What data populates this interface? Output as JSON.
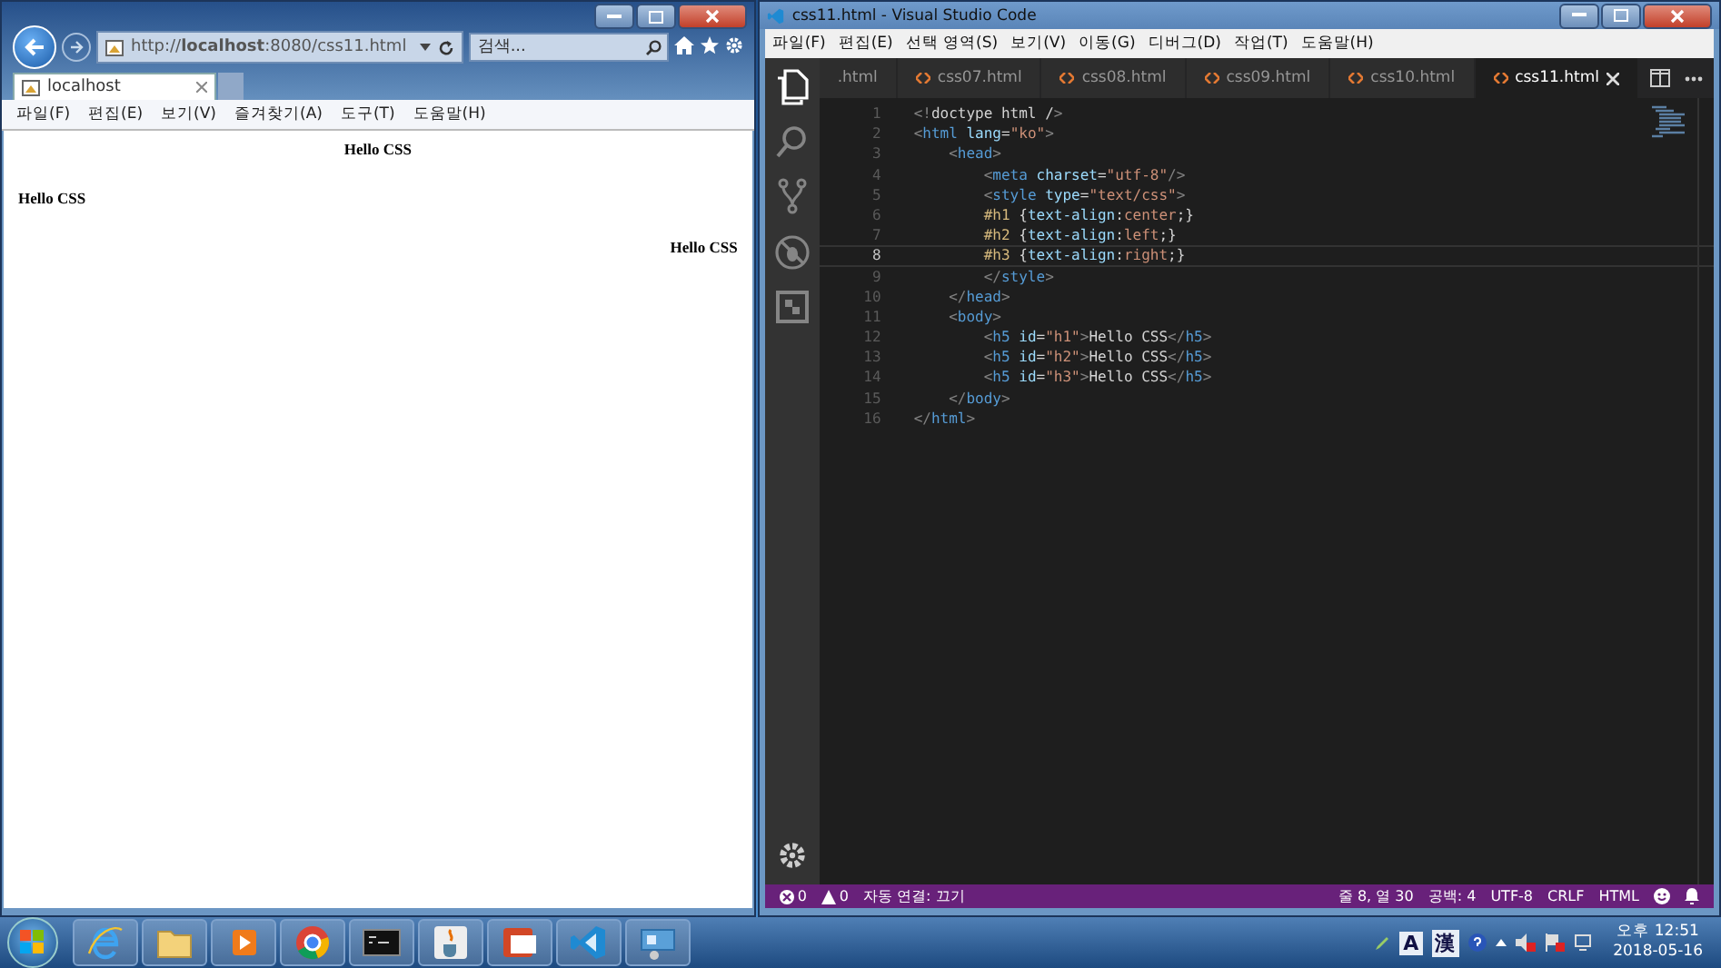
{
  "browser": {
    "address": "http://**localhost**:8080/css11.html",
    "search": {
      "placeholder": "검색..."
    },
    "tabs": [
      {
        "label": "localhost",
        "selected": true
      }
    ],
    "menu": [
      "파일(F)",
      "편집(E)",
      "보기(V)",
      "즐겨찾기(A)",
      "도구(T)",
      "도움말(H)"
    ],
    "page": {
      "headings": [
        {
          "text": "Hello CSS",
          "kind": "center"
        },
        {
          "text": "Hello CSS",
          "kind": "left"
        },
        {
          "text": "Hello CSS",
          "kind": "right"
        }
      ]
    }
  },
  "editor": {
    "window": {
      "title": "css11.html - Visual Studio Code"
    },
    "menu": [
      "파일(F)",
      "편집(E)",
      "선택 영역(S)",
      "보기(V)",
      "이동(G)",
      "디버그(D)",
      "작업(T)",
      "도움말(H)"
    ],
    "activity": [
      {
        "kind": "files",
        "selected": true
      },
      {
        "kind": "search",
        "selected": false
      },
      {
        "kind": "git",
        "selected": false
      },
      {
        "kind": "debug",
        "selected": false
      },
      {
        "kind": "extensions",
        "selected": false
      }
    ],
    "tabs": [
      {
        "label": ".html",
        "selected": false
      },
      {
        "label": "css07.html",
        "selected": false
      },
      {
        "label": "css08.html",
        "selected": false
      },
      {
        "label": "css09.html",
        "selected": false
      },
      {
        "label": "css10.html",
        "selected": false
      },
      {
        "label": "css11.html",
        "selected": true
      }
    ],
    "lines": [
      {
        "number": "1",
        "current": false,
        "tokens": [
          {
            "kind": "punct",
            "text": "<!"
          },
          {
            "kind": "text",
            "text": "doctype html /"
          },
          {
            "kind": "punct",
            "text": ">"
          }
        ]
      },
      {
        "number": "2",
        "current": false,
        "tokens": [
          {
            "kind": "punct",
            "text": "<"
          },
          {
            "kind": "tag",
            "text": "html"
          },
          {
            "kind": "attr",
            "text": " lang"
          },
          {
            "kind": "text",
            "text": "="
          },
          {
            "kind": "str",
            "text": "\"ko\""
          },
          {
            "kind": "punct",
            "text": ">"
          }
        ]
      },
      {
        "number": "3",
        "current": false,
        "tokens": [
          {
            "kind": "punct",
            "text": "    <"
          },
          {
            "kind": "tag",
            "text": "head"
          },
          {
            "kind": "punct",
            "text": ">"
          }
        ]
      },
      {
        "number": "4",
        "current": false,
        "tokens": [
          {
            "kind": "punct",
            "text": "        <"
          },
          {
            "kind": "tag",
            "text": "meta"
          },
          {
            "kind": "attr",
            "text": " charset"
          },
          {
            "kind": "text",
            "text": "="
          },
          {
            "kind": "str",
            "text": "\"utf-8\""
          },
          {
            "kind": "punct",
            "text": "/>"
          }
        ]
      },
      {
        "number": "5",
        "current": false,
        "tokens": [
          {
            "kind": "punct",
            "text": "        <"
          },
          {
            "kind": "tag",
            "text": "style"
          },
          {
            "kind": "attr",
            "text": " type"
          },
          {
            "kind": "text",
            "text": "="
          },
          {
            "kind": "str",
            "text": "\"text/css\""
          },
          {
            "kind": "punct",
            "text": ">"
          }
        ]
      },
      {
        "number": "6",
        "current": false,
        "tokens": [
          {
            "kind": "sel",
            "text": "        #h1"
          },
          {
            "kind": "text",
            "text": " {"
          },
          {
            "kind": "attr",
            "text": "text-align"
          },
          {
            "kind": "text",
            "text": ":"
          },
          {
            "kind": "str",
            "text": "center"
          },
          {
            "kind": "text",
            "text": ";}"
          }
        ]
      },
      {
        "number": "7",
        "current": false,
        "tokens": [
          {
            "kind": "sel",
            "text": "        #h2"
          },
          {
            "kind": "text",
            "text": " {"
          },
          {
            "kind": "attr",
            "text": "text-align"
          },
          {
            "kind": "text",
            "text": ":"
          },
          {
            "kind": "str",
            "text": "left"
          },
          {
            "kind": "text",
            "text": ";}"
          }
        ]
      },
      {
        "number": "8",
        "current": true,
        "tokens": [
          {
            "kind": "sel",
            "text": "        #h3"
          },
          {
            "kind": "text",
            "text": " {"
          },
          {
            "kind": "attr",
            "text": "text-align"
          },
          {
            "kind": "text",
            "text": ":"
          },
          {
            "kind": "str",
            "text": "right"
          },
          {
            "kind": "text",
            "text": ";}"
          }
        ]
      },
      {
        "number": "9",
        "current": false,
        "tokens": [
          {
            "kind": "punct",
            "text": "        </"
          },
          {
            "kind": "tag",
            "text": "style"
          },
          {
            "kind": "punct",
            "text": ">"
          }
        ]
      },
      {
        "number": "10",
        "current": false,
        "tokens": [
          {
            "kind": "punct",
            "text": "    </"
          },
          {
            "kind": "tag",
            "text": "head"
          },
          {
            "kind": "punct",
            "text": ">"
          }
        ]
      },
      {
        "number": "11",
        "current": false,
        "tokens": [
          {
            "kind": "punct",
            "text": "    <"
          },
          {
            "kind": "tag",
            "text": "body"
          },
          {
            "kind": "punct",
            "text": ">"
          }
        ]
      },
      {
        "number": "12",
        "current": false,
        "tokens": [
          {
            "kind": "punct",
            "text": "        <"
          },
          {
            "kind": "tag",
            "text": "h5"
          },
          {
            "kind": "attr",
            "text": " id"
          },
          {
            "kind": "text",
            "text": "="
          },
          {
            "kind": "str",
            "text": "\"h1\""
          },
          {
            "kind": "punct",
            "text": ">"
          },
          {
            "kind": "text",
            "text": "Hello CSS"
          },
          {
            "kind": "punct",
            "text": "</"
          },
          {
            "kind": "tag",
            "text": "h5"
          },
          {
            "kind": "punct",
            "text": ">"
          }
        ]
      },
      {
        "number": "13",
        "current": false,
        "tokens": [
          {
            "kind": "punct",
            "text": "        <"
          },
          {
            "kind": "tag",
            "text": "h5"
          },
          {
            "kind": "attr",
            "text": " id"
          },
          {
            "kind": "text",
            "text": "="
          },
          {
            "kind": "str",
            "text": "\"h2\""
          },
          {
            "kind": "punct",
            "text": ">"
          },
          {
            "kind": "text",
            "text": "Hello CSS"
          },
          {
            "kind": "punct",
            "text": "</"
          },
          {
            "kind": "tag",
            "text": "h5"
          },
          {
            "kind": "punct",
            "text": ">"
          }
        ]
      },
      {
        "number": "14",
        "current": false,
        "tokens": [
          {
            "kind": "punct",
            "text": "        <"
          },
          {
            "kind": "tag",
            "text": "h5"
          },
          {
            "kind": "attr",
            "text": " id"
          },
          {
            "kind": "text",
            "text": "="
          },
          {
            "kind": "str",
            "text": "\"h3\""
          },
          {
            "kind": "punct",
            "text": ">"
          },
          {
            "kind": "text",
            "text": "Hello CSS"
          },
          {
            "kind": "punct",
            "text": "</"
          },
          {
            "kind": "tag",
            "text": "h5"
          },
          {
            "kind": "punct",
            "text": ">"
          }
        ]
      },
      {
        "number": "15",
        "current": false,
        "tokens": [
          {
            "kind": "punct",
            "text": "    </"
          },
          {
            "kind": "tag",
            "text": "body"
          },
          {
            "kind": "punct",
            "text": ">"
          }
        ]
      },
      {
        "number": "16",
        "current": false,
        "tokens": [
          {
            "kind": "punct",
            "text": "</"
          },
          {
            "kind": "tag",
            "text": "html"
          },
          {
            "kind": "punct",
            "text": ">"
          }
        ]
      }
    ],
    "status_bar": {
      "errors": "0",
      "warnings": "0",
      "live_share": "자동 연결: 끄기",
      "right": [
        "줄 8, 열 30",
        "공백: 4",
        "UTF-8",
        "CRLF",
        "HTML"
      ]
    }
  },
  "taskbar": {
    "apps": [
      {
        "kind": "ie"
      },
      {
        "kind": "folder"
      },
      {
        "kind": "player"
      },
      {
        "kind": "chrome"
      },
      {
        "kind": "console"
      },
      {
        "kind": "java"
      },
      {
        "kind": "slides"
      },
      {
        "kind": "vscode"
      },
      {
        "kind": "network"
      }
    ],
    "ime": [
      "A",
      "漢"
    ],
    "time": "오후 12:51",
    "date": "2018-05-16"
  }
}
